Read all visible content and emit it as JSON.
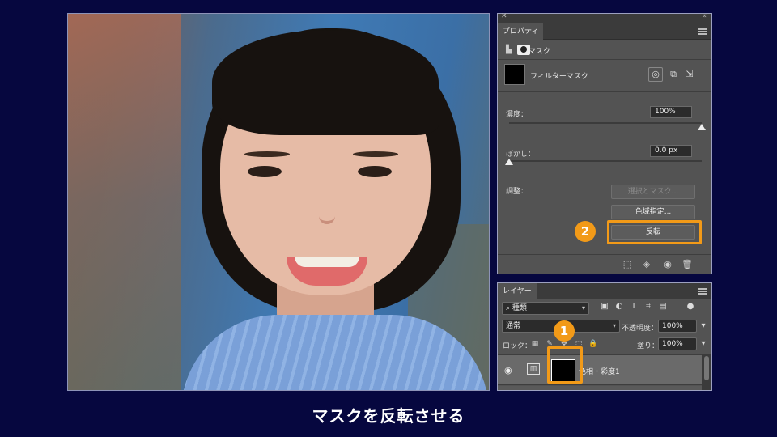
{
  "caption": "マスクを反転させる",
  "colors": {
    "background": "#06073f",
    "accent": "#f29a18",
    "panel": "#535353"
  },
  "properties": {
    "tab": "プロパティ",
    "mask_title": "マスク",
    "filter_mask": "フィルターマスク",
    "density_label": "濃度：",
    "density_value": "100%",
    "density_fraction": 1.0,
    "feather_label": "ぼかし：",
    "feather_value": "0.0 px",
    "feather_fraction": 0.0,
    "adjust_label": "調整：",
    "select_and_mask": "選択とマスク...",
    "color_range": "色域指定...",
    "invert": "反転"
  },
  "layers": {
    "tab": "レイヤー",
    "filter_kind": "種類",
    "blend_mode": "通常",
    "opacity_label": "不透明度：",
    "opacity_value": "100%",
    "lock_label": "ロック：",
    "fill_label": "塗り：",
    "fill_value": "100%",
    "layer_name": "色相・彩度1"
  },
  "callouts": {
    "one": "1",
    "two": "2"
  },
  "icons": [
    "close-icon",
    "collapse-icon",
    "panel-menu-icon",
    "pixel-mask-icon",
    "vector-mask-icon",
    "load-selection-icon",
    "apply-mask-icon",
    "disable-mask-icon",
    "delete-icon",
    "eye-icon",
    "search-icon",
    "lock-icon",
    "brush-icon",
    "move-icon",
    "artboard-icon"
  ]
}
